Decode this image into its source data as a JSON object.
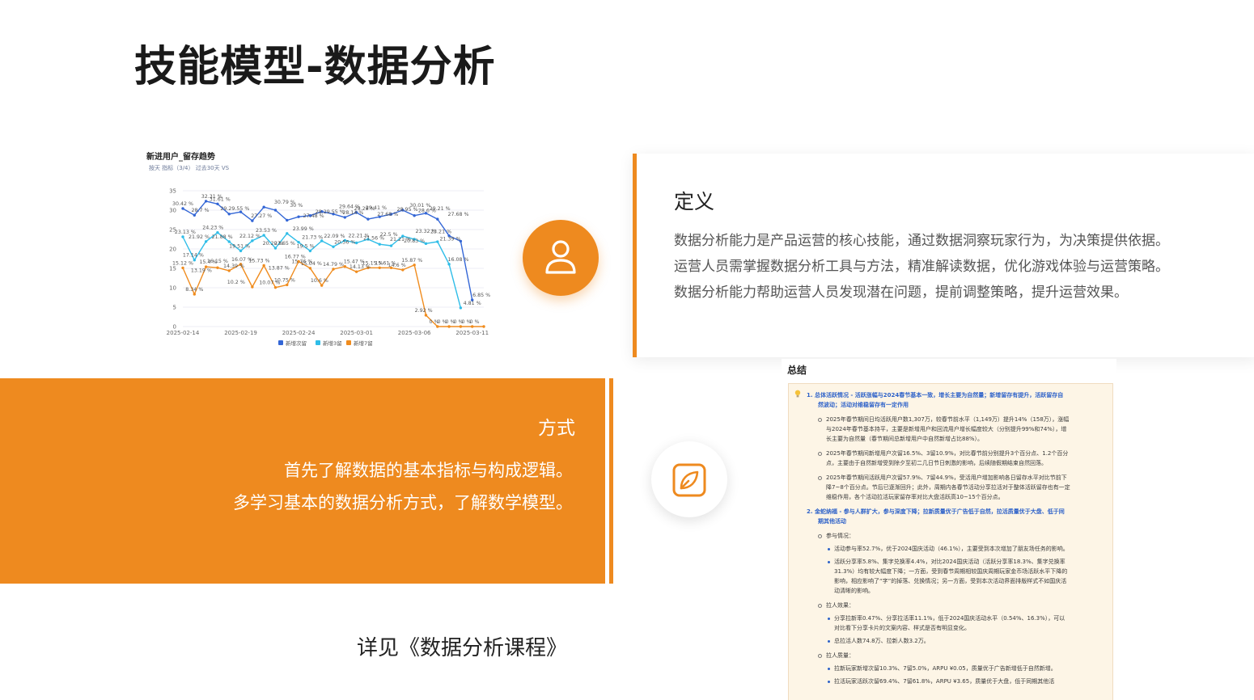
{
  "slide": {
    "title": "技能模型-数据分析"
  },
  "chart_data": {
    "type": "line",
    "title": "新进用户_留存趋势",
    "subtitle": "按天   指标（3/4）   过去30天   VS",
    "xlabel": "",
    "ylabel": "",
    "ylim": [
      0,
      35
    ],
    "yticks": [
      0,
      5,
      10,
      15,
      20,
      25,
      30,
      35
    ],
    "xtick_labels": [
      {
        "index": 0,
        "label": "2025-02-14"
      },
      {
        "index": 5,
        "label": "2025-02-19"
      },
      {
        "index": 10,
        "label": "2025-02-24"
      },
      {
        "index": 15,
        "label": "2025-03-01"
      },
      {
        "index": 20,
        "label": "2025-03-06"
      },
      {
        "index": 25,
        "label": "2025-03-11"
      }
    ],
    "legend_position": "bottom",
    "grid": true,
    "series": [
      {
        "name": "新增次留",
        "color": "#3366d6",
        "values": [
          30.42,
          28.7,
          32.31,
          31.61,
          29,
          29.55,
          27.27,
          30.79,
          30,
          27.4,
          28.3,
          28.6,
          29.64,
          29,
          28.14,
          29.4,
          27.68,
          28.3,
          28.95,
          30.01,
          28.6,
          29.21,
          27.68,
          23.4,
          22,
          6.85
        ]
      },
      {
        "name": "新增3留",
        "color": "#2fbde8",
        "values": [
          23.13,
          17.14,
          21.92,
          24.23,
          21.88,
          19.51,
          22.12,
          23.53,
          20.2,
          23.99,
          21.73,
          19.5,
          22.09,
          20.56,
          22.21,
          21.56,
          22.5,
          21.21,
          20.83,
          23.32,
          22.5,
          21.39,
          21.87,
          16.08,
          4.81
        ]
      },
      {
        "name": "新增7留",
        "color": "#f08c1e",
        "values": [
          15.12,
          8.34,
          15.4,
          15.16,
          14.39,
          16.07,
          10.2,
          15.73,
          10.07,
          10.75,
          16.77,
          15.04,
          10.6,
          14.79,
          15.47,
          14.13,
          15.15,
          15.15,
          15.15,
          14.6,
          15.87,
          2.92,
          0,
          0,
          0,
          0,
          0
        ]
      }
    ],
    "data_labels": [
      {
        "text": "30.42 %",
        "x": 0,
        "y": 30.42,
        "series": 0
      },
      {
        "text": "28.7 %",
        "x": 1.5,
        "y": 28.7,
        "series": 0
      },
      {
        "text": "32.31 %",
        "x": 2.5,
        "y": 32.31,
        "series": 0
      },
      {
        "text": "31.61 %",
        "x": 3.2,
        "y": 31.61,
        "series": 0
      },
      {
        "text": "29.29.55 %",
        "x": 4.5,
        "y": 29.2,
        "series": 0
      },
      {
        "text": "27.27 %",
        "x": 6.8,
        "y": 27.27,
        "series": 0
      },
      {
        "text": "30.79 %",
        "x": 8.8,
        "y": 30.79,
        "series": 0
      },
      {
        "text": "30 %",
        "x": 9.8,
        "y": 30,
        "series": 0
      },
      {
        "text": "27.48 %",
        "x": 11.3,
        "y": 27.3,
        "series": 0
      },
      {
        "text": "28.29.55 %",
        "x": 12.7,
        "y": 28.3,
        "series": 0
      },
      {
        "text": "29.64 %",
        "x": 14.4,
        "y": 29.64,
        "series": 0
      },
      {
        "text": "29.29 %",
        "x": 15.7,
        "y": 29.2,
        "series": 0
      },
      {
        "text": "28.14 %",
        "x": 14.7,
        "y": 28.14,
        "series": 0
      },
      {
        "text": "29.41 %",
        "x": 16.7,
        "y": 29.4,
        "series": 0
      },
      {
        "text": "27.68 %",
        "x": 17.7,
        "y": 27.68,
        "series": 0
      },
      {
        "text": "28.95 %",
        "x": 19.4,
        "y": 28.95,
        "series": 0
      },
      {
        "text": "30.01 %",
        "x": 20.5,
        "y": 30.01,
        "series": 0
      },
      {
        "text": "28.6 %",
        "x": 21.1,
        "y": 28.6,
        "series": 0
      },
      {
        "text": "29.21 %",
        "x": 22.2,
        "y": 29.21,
        "series": 0
      },
      {
        "text": "27.68 %",
        "x": 23.8,
        "y": 27.68,
        "series": 0
      },
      {
        "text": "6.85 %",
        "x": 25.8,
        "y": 6.85,
        "series": 0
      },
      {
        "text": "23.13 %",
        "x": 0.2,
        "y": 23.13,
        "series": 1
      },
      {
        "text": "17.14 %",
        "x": 0.9,
        "y": 17.14,
        "series": 1
      },
      {
        "text": "21.92 %",
        "x": 1.4,
        "y": 21.92,
        "series": 1
      },
      {
        "text": "24.23 %",
        "x": 2.6,
        "y": 24.23,
        "series": 1
      },
      {
        "text": "21.88 %",
        "x": 3.4,
        "y": 21.88,
        "series": 1
      },
      {
        "text": "22.12 %",
        "x": 5.8,
        "y": 22.12,
        "series": 1
      },
      {
        "text": "19.51 %",
        "x": 4.9,
        "y": 19.51,
        "series": 1
      },
      {
        "text": "23.53 %",
        "x": 7.2,
        "y": 23.53,
        "series": 1
      },
      {
        "text": "20.20 %",
        "x": 7.8,
        "y": 20.2,
        "series": 1
      },
      {
        "text": "23.65 %",
        "x": 8.8,
        "y": 20.2,
        "series": 1
      },
      {
        "text": "23.99 %",
        "x": 10.4,
        "y": 23.99,
        "series": 1
      },
      {
        "text": "21.73 %",
        "x": 11.2,
        "y": 21.73,
        "series": 1
      },
      {
        "text": "19.5 %",
        "x": 10.6,
        "y": 19.5,
        "series": 1
      },
      {
        "text": "22.09 %",
        "x": 13.1,
        "y": 22.09,
        "series": 1
      },
      {
        "text": "20.56 %",
        "x": 14.0,
        "y": 20.56,
        "series": 1
      },
      {
        "text": "22.21 %",
        "x": 15.2,
        "y": 22.21,
        "series": 1
      },
      {
        "text": "21.56 %",
        "x": 16.5,
        "y": 21.56,
        "series": 1
      },
      {
        "text": "22.5 %",
        "x": 17.8,
        "y": 22.5,
        "series": 1
      },
      {
        "text": "21.21 %",
        "x": 18.8,
        "y": 21.21,
        "series": 1
      },
      {
        "text": "20.83 %",
        "x": 20.0,
        "y": 20.83,
        "series": 1
      },
      {
        "text": "23.32 %",
        "x": 21.0,
        "y": 23.32,
        "series": 1
      },
      {
        "text": "23.21 %",
        "x": 22.3,
        "y": 23.21,
        "series": 1
      },
      {
        "text": "21.39 %",
        "x": 23.1,
        "y": 21.39,
        "series": 1
      },
      {
        "text": "16.08 %",
        "x": 23.8,
        "y": 16.08,
        "series": 1
      },
      {
        "text": "4.81 %",
        "x": 25.0,
        "y": 4.81,
        "series": 1
      },
      {
        "text": "15.12 %",
        "x": 0,
        "y": 15.12,
        "series": 2
      },
      {
        "text": "8.34 %",
        "x": 1.0,
        "y": 8.34,
        "series": 2
      },
      {
        "text": "13.19 %",
        "x": 1.6,
        "y": 13.19,
        "series": 2
      },
      {
        "text": "15.4 %",
        "x": 2.2,
        "y": 15.4,
        "series": 2
      },
      {
        "text": "16.15 %",
        "x": 3.0,
        "y": 15.6,
        "series": 2
      },
      {
        "text": "14.39 %",
        "x": 4.4,
        "y": 14.39,
        "series": 2
      },
      {
        "text": "16.07 %",
        "x": 5.1,
        "y": 16.07,
        "series": 2
      },
      {
        "text": "15.73 %",
        "x": 6.6,
        "y": 15.73,
        "series": 2
      },
      {
        "text": "10.2 %",
        "x": 4.6,
        "y": 10.2,
        "series": 2
      },
      {
        "text": "10.07 %",
        "x": 7.5,
        "y": 10.07,
        "series": 2
      },
      {
        "text": "10.75 %",
        "x": 8.8,
        "y": 10.75,
        "series": 2
      },
      {
        "text": "13.87 %",
        "x": 8.3,
        "y": 13.87,
        "series": 2
      },
      {
        "text": "16.77 %",
        "x": 9.7,
        "y": 16.77,
        "series": 2
      },
      {
        "text": "15.76 %",
        "x": 10.3,
        "y": 15.5,
        "series": 2
      },
      {
        "text": "15.04 %",
        "x": 11.1,
        "y": 15.04,
        "series": 2
      },
      {
        "text": "10.6 %",
        "x": 11.8,
        "y": 10.6,
        "series": 2
      },
      {
        "text": "14.79 %",
        "x": 13.0,
        "y": 14.79,
        "series": 2
      },
      {
        "text": "15.47 %",
        "x": 14.8,
        "y": 15.47,
        "series": 2
      },
      {
        "text": "14.13 %",
        "x": 15.3,
        "y": 14.13,
        "series": 2
      },
      {
        "text": "15.15 %",
        "x": 16.4,
        "y": 15.15,
        "series": 2
      },
      {
        "text": "15.61 %",
        "x": 17.5,
        "y": 15.15,
        "series": 2
      },
      {
        "text": "14.6 %",
        "x": 18.5,
        "y": 14.6,
        "series": 2
      },
      {
        "text": "15.87 %",
        "x": 19.8,
        "y": 15.87,
        "series": 2
      },
      {
        "text": "2.92 %",
        "x": 20.8,
        "y": 2.92,
        "series": 2
      },
      {
        "text": "0 %",
        "x": 21.7,
        "y": 0,
        "series": 2
      },
      {
        "text": "0 %",
        "x": 22.4,
        "y": 0,
        "series": 2
      },
      {
        "text": "0 %",
        "x": 23.1,
        "y": 0,
        "series": 2
      },
      {
        "text": "0 %",
        "x": 23.8,
        "y": 0,
        "series": 2
      },
      {
        "text": "0 %",
        "x": 24.5,
        "y": 0,
        "series": 2
      },
      {
        "text": "0 %",
        "x": 25.2,
        "y": 0,
        "series": 2
      }
    ]
  },
  "definition": {
    "heading": "定义",
    "lines": [
      "数据分析能力是产品运营的核心技能，通过数据洞察玩家行为，为决策提供依据。",
      "运营人员需掌握数据分析工具与方法，精准解读数据，优化游戏体验与运营策略。",
      "数据分析能力帮助运营人员发现潜在问题，提前调整策略，提升运营效果。"
    ]
  },
  "method": {
    "heading": "方式",
    "lines": [
      "首先了解数据的基本指标与构成逻辑。",
      "多学习基本的数据分析方式，了解数学模型。"
    ]
  },
  "see_course": "详见《数据分析课程》",
  "summary": {
    "title": "总结",
    "lines": [
      "1.  总体活跃情况 - 活跃涨幅与2024春节基本一致，增长主要为自然量；新增留存有提升，活跃留存自",
      "然波动；活动对维稳留存有一定作用",
      "2025年春节期间日均活跃用户数1,307万，较春节前水平（1,149万）提升14%（158万），涨幅",
      "与2024年春节基本持平，主要是新增用户和回流用户增长幅度较大（分别提升99%和74%），增",
      "长主要为自然量（春节期间总新增用户中自然新增占比88%）。",
      "2025年春节期间新增用户次留16.5%、3留10.9%，对比春节前分别提升3个百分点、1.2个百分",
      "点，主要由于自然新增受到除夕至初二几日节日刺激的影响，后续随假期结束自然回落。",
      "2025年春节期间活跃用户次留57.9%、7留44.9%，受活用户增加影响各日留存水平对比节前下",
      "降7~8个百分点。节后已逐渐回升；此外，周期内各春节活动分享拉活对于整体活跃留存也有一定",
      "维稳作用，各个活动拉活玩家留存率对比大盘活跃高10~15个百分点。",
      "2.  金蛇纳福 - 参与人群扩大，参与深度下降；拉新质量优于广告低于自然，拉活质量优于大盘、低于同",
      "期其他活动",
      "参与情况：",
      "活动参与率52.7%，优于2024国庆活动（46.1%），主要受到本次增加了朋友场任务的影响。",
      "活跃分享率5.8%、集字兑换率4.4%，对比2024国庆活动（活跃分享率18.3%、集字兑换率",
      "31.3%）均有较大幅度下降；一方面，受到春节周期相较国庆周期玩家金币场活跃水平下降的",
      "影响，相应影响了“字”的掉落、兑换情况；另一方面，受到本次活动界面排版样式不如国庆活",
      "动清晰的影响。",
      "拉人效果：",
      "分享拉新率0.47%、分享拉活率11.1%，低于2024国庆活动水平（0.54%、16.3%），可以",
      "对比看下分享卡片的文案内容、样式是否有明显变化。",
      "总拉活人数74.8万、拉新人数3.2万。",
      "拉人质量：",
      "拉新玩家新增次留10.3%、7留5.0%，ARPU ¥0.05，质量优于广告新增低于自然新增。",
      "拉活玩家活跃次留69.4%、7留61.8%，ARPU ¥3.65，质量优于大盘，低于同期其他活"
    ]
  },
  "colors": {
    "accent": "#ee8a1f",
    "series_blue": "#3366d6",
    "series_cyan": "#2fbde8",
    "series_orange": "#f08c1e",
    "summary_link": "#2e62c9"
  },
  "icons": [
    "user-icon",
    "edit-leaf-icon",
    "lightbulb-icon"
  ]
}
